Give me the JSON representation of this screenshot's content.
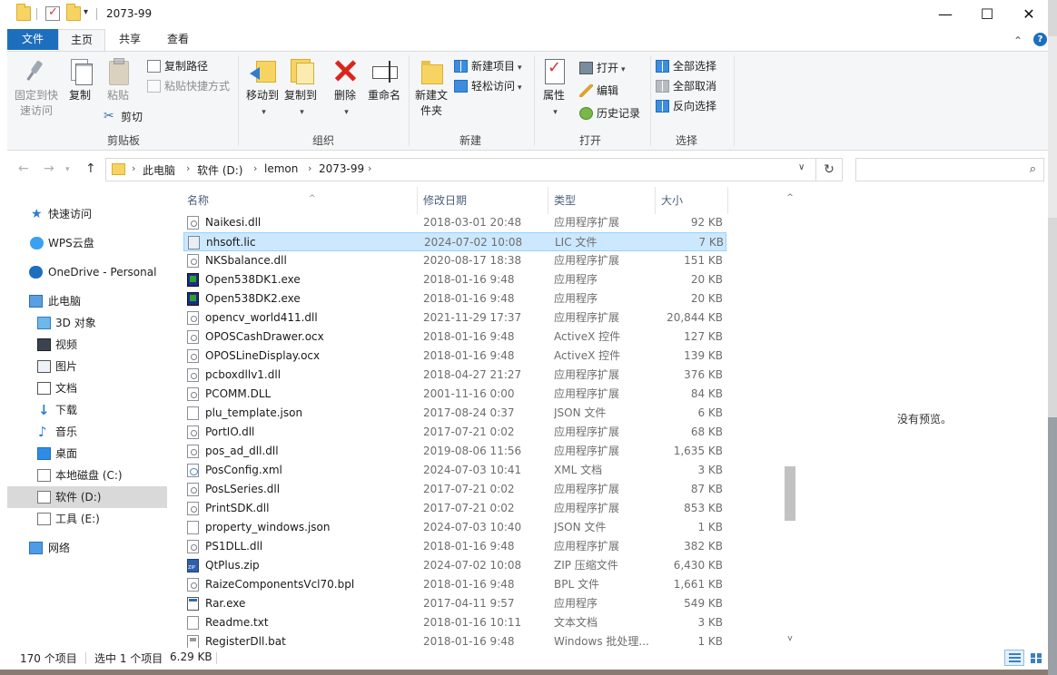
{
  "window": {
    "title": "2073-99",
    "buttons": {
      "minimize": "—",
      "maximize": "☐",
      "close": "✕"
    }
  },
  "tabs": [
    {
      "label": "文件"
    },
    {
      "label": "主页"
    },
    {
      "label": "共享"
    },
    {
      "label": "查看"
    }
  ],
  "tabrow_right": {
    "expand": "⌃"
  },
  "ribbon": {
    "clipboard": {
      "group": "剪贴板",
      "pin": "固定到快速访问",
      "copy": "复制",
      "paste": "粘贴",
      "copy_path": "复制路径",
      "paste_shortcut": "粘贴快捷方式",
      "cut": "剪切"
    },
    "organize": {
      "group": "组织",
      "move_to": "移动到",
      "copy_to": "复制到",
      "delete": "删除",
      "rename": "重命名"
    },
    "new": {
      "group": "新建",
      "new_folder": "新建文件夹",
      "new_item": "新建项目",
      "easy_access": "轻松访问"
    },
    "open": {
      "group": "打开",
      "properties": "属性",
      "open": "打开",
      "edit": "编辑",
      "history": "历史记录"
    },
    "select": {
      "group": "选择",
      "select_all": "全部选择",
      "select_none": "全部取消",
      "invert": "反向选择"
    }
  },
  "address": {
    "crumbs": [
      "此电脑",
      "软件 (D:)",
      "lemon",
      "2073-99"
    ],
    "search_placeholder": ""
  },
  "nav": {
    "quick_access": "快速访问",
    "wps": "WPS云盘",
    "onedrive": "OneDrive - Personal",
    "this_pc": "此电脑",
    "objects3d": "3D 对象",
    "videos": "视频",
    "pictures": "图片",
    "documents": "文档",
    "downloads": "下载",
    "music": "音乐",
    "desktop": "桌面",
    "drive_c": "本地磁盘 (C:)",
    "drive_d": "软件 (D:)",
    "drive_e": "工具 (E:)",
    "network": "网络"
  },
  "columns": {
    "name": "名称",
    "date": "修改日期",
    "type": "类型",
    "size": "大小"
  },
  "files": [
    {
      "name": "Naikesi.dll",
      "date": "2018-03-01 20:48",
      "type": "应用程序扩展",
      "size": "92 KB",
      "icon": "dll"
    },
    {
      "name": "nhsoft.lic",
      "date": "2024-07-02 10:08",
      "type": "LIC 文件",
      "size": "7 KB",
      "icon": "lic",
      "selected": true
    },
    {
      "name": "NKSbalance.dll",
      "date": "2020-08-17 18:38",
      "type": "应用程序扩展",
      "size": "151 KB",
      "icon": "dll"
    },
    {
      "name": "Open538DK1.exe",
      "date": "2018-01-16 9:48",
      "type": "应用程序",
      "size": "20 KB",
      "icon": "exe"
    },
    {
      "name": "Open538DK2.exe",
      "date": "2018-01-16 9:48",
      "type": "应用程序",
      "size": "20 KB",
      "icon": "exe"
    },
    {
      "name": "opencv_world411.dll",
      "date": "2021-11-29 17:37",
      "type": "应用程序扩展",
      "size": "20,844 KB",
      "icon": "dll"
    },
    {
      "name": "OPOSCashDrawer.ocx",
      "date": "2018-01-16 9:48",
      "type": "ActiveX 控件",
      "size": "127 KB",
      "icon": "dll"
    },
    {
      "name": "OPOSLineDisplay.ocx",
      "date": "2018-01-16 9:48",
      "type": "ActiveX 控件",
      "size": "139 KB",
      "icon": "dll"
    },
    {
      "name": "pcboxdllv1.dll",
      "date": "2018-04-27 21:27",
      "type": "应用程序扩展",
      "size": "376 KB",
      "icon": "dll"
    },
    {
      "name": "PCOMM.DLL",
      "date": "2001-11-16 0:00",
      "type": "应用程序扩展",
      "size": "84 KB",
      "icon": "dll"
    },
    {
      "name": "plu_template.json",
      "date": "2017-08-24 0:37",
      "type": "JSON 文件",
      "size": "6 KB",
      "icon": "doc"
    },
    {
      "name": "PortIO.dll",
      "date": "2017-07-21 0:02",
      "type": "应用程序扩展",
      "size": "68 KB",
      "icon": "dll"
    },
    {
      "name": "pos_ad_dll.dll",
      "date": "2019-08-06 11:56",
      "type": "应用程序扩展",
      "size": "1,635 KB",
      "icon": "dll"
    },
    {
      "name": "PosConfig.xml",
      "date": "2024-07-03 10:41",
      "type": "XML 文档",
      "size": "3 KB",
      "icon": "xml"
    },
    {
      "name": "PosLSeries.dll",
      "date": "2017-07-21 0:02",
      "type": "应用程序扩展",
      "size": "87 KB",
      "icon": "dll"
    },
    {
      "name": "PrintSDK.dll",
      "date": "2017-07-21 0:02",
      "type": "应用程序扩展",
      "size": "853 KB",
      "icon": "dll"
    },
    {
      "name": "property_windows.json",
      "date": "2024-07-03 10:40",
      "type": "JSON 文件",
      "size": "1 KB",
      "icon": "doc"
    },
    {
      "name": "PS1DLL.dll",
      "date": "2018-01-16 9:48",
      "type": "应用程序扩展",
      "size": "382 KB",
      "icon": "dll"
    },
    {
      "name": "QtPlus.zip",
      "date": "2024-07-02 10:08",
      "type": "ZIP 压缩文件",
      "size": "6,430 KB",
      "icon": "zip"
    },
    {
      "name": "RaizeComponentsVcl70.bpl",
      "date": "2018-01-16 9:48",
      "type": "BPL 文件",
      "size": "1,661 KB",
      "icon": "dll"
    },
    {
      "name": "Rar.exe",
      "date": "2017-04-11 9:57",
      "type": "应用程序",
      "size": "549 KB",
      "icon": "app"
    },
    {
      "name": "Readme.txt",
      "date": "2018-01-16 10:11",
      "type": "文本文档",
      "size": "3 KB",
      "icon": "doc"
    },
    {
      "name": "RegisterDll.bat",
      "date": "2018-01-16 9:48",
      "type": "Windows 批处理...",
      "size": "1 KB",
      "icon": "bat"
    }
  ],
  "preview": {
    "message": "没有预览。"
  },
  "status": {
    "item_count": "170 个项目",
    "selected": "选中 1 个项目",
    "selected_size": "6.29 KB"
  }
}
